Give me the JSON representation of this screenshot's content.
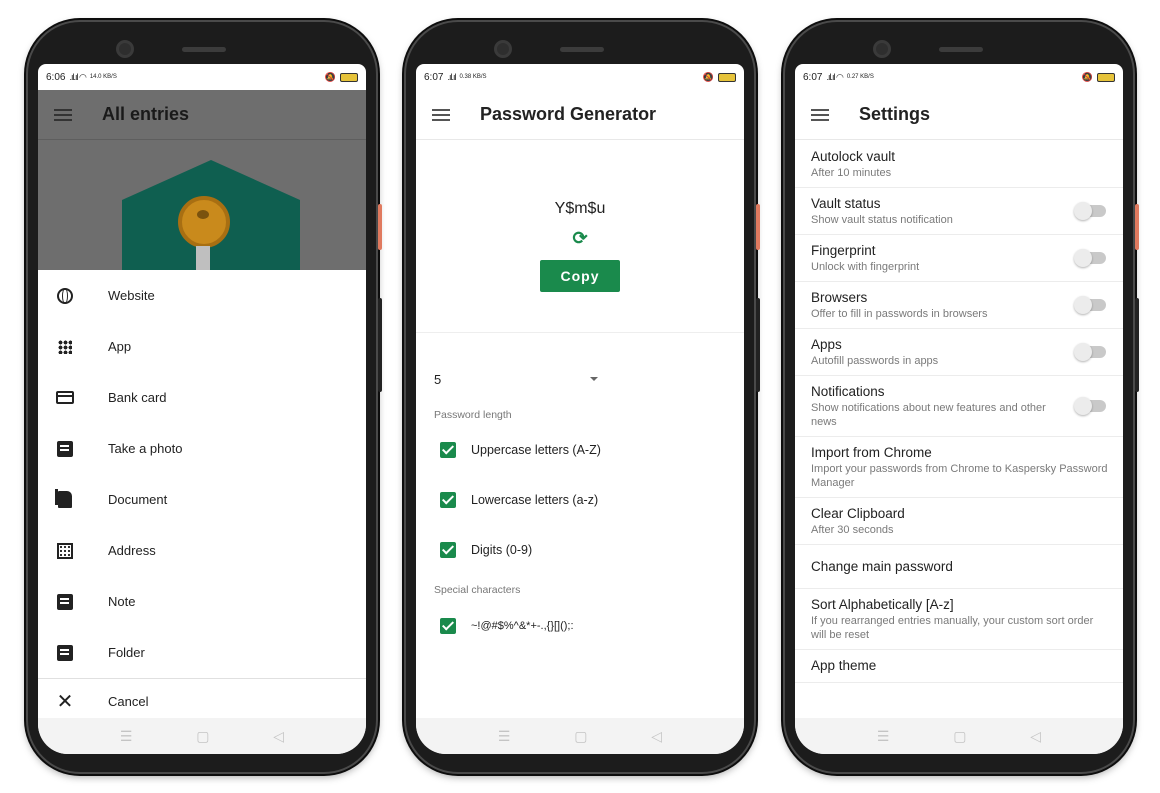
{
  "phones": [
    {
      "status": {
        "time": "6:06",
        "net": "14.0 KB/S"
      },
      "title": "All entries",
      "menu": [
        {
          "label": "Website",
          "icon": "globe-icon"
        },
        {
          "label": "App",
          "icon": "grid-icon"
        },
        {
          "label": "Bank card",
          "icon": "card-icon"
        },
        {
          "label": "Take a photo",
          "icon": "note-icon"
        },
        {
          "label": "Document",
          "icon": "document-icon"
        },
        {
          "label": "Address",
          "icon": "building-icon"
        },
        {
          "label": "Note",
          "icon": "note-icon"
        },
        {
          "label": "Folder",
          "icon": "note-icon"
        }
      ],
      "cancel": "Cancel"
    },
    {
      "status": {
        "time": "6:07",
        "net": "0.38 KB/S"
      },
      "title": "Password Generator",
      "password": "Y$m$u",
      "copy": "Copy",
      "length_value": "5",
      "length_label": "Password length",
      "options": [
        {
          "label": "Uppercase letters (A-Z)",
          "checked": true
        },
        {
          "label": "Lowercase letters (a-z)",
          "checked": true
        },
        {
          "label": "Digits (0-9)",
          "checked": true
        }
      ],
      "special_label": "Special characters",
      "special_option": {
        "label": "~!@#$%^&*+-.,{}[]();:",
        "checked": true
      }
    },
    {
      "status": {
        "time": "6:07",
        "net": "0.27 KB/S"
      },
      "title": "Settings",
      "settings": [
        {
          "title": "Autolock vault",
          "desc": "After 10 minutes",
          "toggle": false
        },
        {
          "title": "Vault status",
          "desc": "Show vault status notification",
          "toggle": true,
          "on": false
        },
        {
          "title": "Fingerprint",
          "desc": "Unlock with fingerprint",
          "toggle": true,
          "on": false
        },
        {
          "title": "Browsers",
          "desc": "Offer to fill in passwords in browsers",
          "toggle": true,
          "on": false
        },
        {
          "title": "Apps",
          "desc": "Autofill passwords in apps",
          "toggle": true,
          "on": false
        },
        {
          "title": "Notifications",
          "desc": "Show notifications about new features and other news",
          "toggle": true,
          "on": false
        },
        {
          "title": "Import from Chrome",
          "desc": "Import your passwords from Chrome to Kaspersky Password Manager",
          "toggle": false
        },
        {
          "title": "Clear Clipboard",
          "desc": "After 30 seconds",
          "toggle": false
        },
        {
          "title": "Change main password",
          "desc": "",
          "toggle": false
        },
        {
          "title": "Sort Alphabetically [A-z]",
          "desc": "If you rearranged entries manually, your custom sort order will be reset",
          "toggle": false
        },
        {
          "title": "App theme",
          "desc": "",
          "toggle": false
        }
      ]
    }
  ],
  "colors": {
    "accent": "#1a8a4c",
    "brand_house": "#0f5f50",
    "key": "#c98a1c",
    "scrim": "#6e6e6e"
  },
  "nav": {
    "menu_glyph": "☰",
    "home_glyph": "▢",
    "back_glyph": "◁"
  }
}
